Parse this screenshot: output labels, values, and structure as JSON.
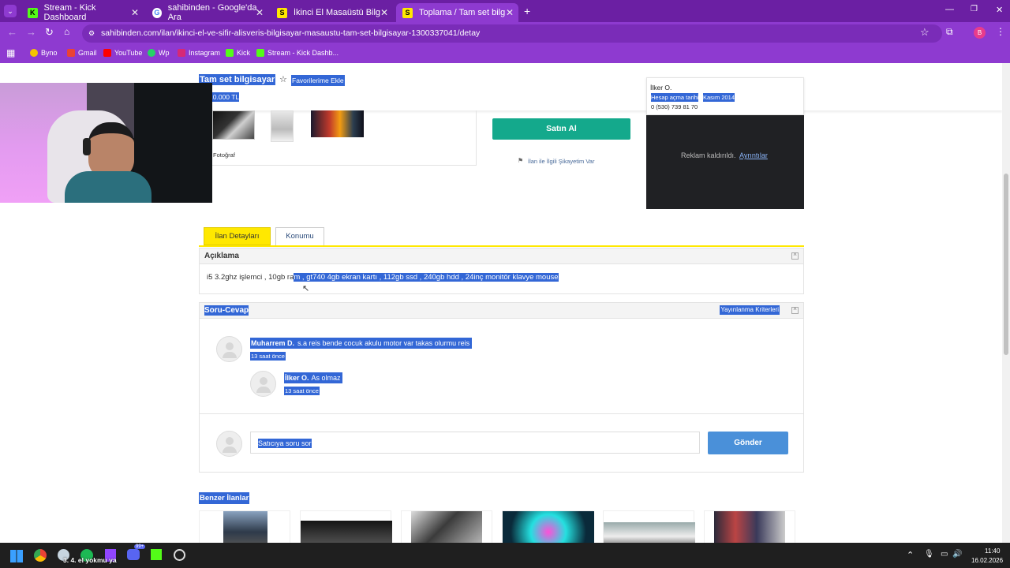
{
  "browser": {
    "tabs": [
      {
        "label": "Stream - Kick Dashboard",
        "icon": "kick-icon"
      },
      {
        "label": "sahibinden - Google'da Ara",
        "icon": "google-icon"
      },
      {
        "label": "İkinci El Masaüstü Bilgisayar M...",
        "icon": "sahibinden-icon"
      },
      {
        "label": "Toplama / Tam set bilgisayar sa...",
        "icon": "sahibinden-icon"
      }
    ],
    "url": "sahibinden.com/ilan/ikinci-el-ve-sifir-alisveris-bilgisayar-masaustu-tam-set-bilgisayar-1300337041/detay",
    "profile_initial": "B",
    "bookmarks": [
      "Byno",
      "Gmail",
      "YouTube",
      "Wp",
      "Instagram",
      "Kick",
      "Stream - Kick Dashb..."
    ]
  },
  "listing": {
    "title": "Tam set bilgisayar",
    "favorite_label": "Favorilerime Ekle",
    "price": "10.000 TL",
    "photo_label": "Fotoğraf",
    "buy_label": "Satın Al",
    "complaint_label": "İlan ile İlgili Şikayetim Var"
  },
  "seller": {
    "name": "İlker O.",
    "since_label": "Hesap açma tarihi",
    "since_value": "Kasım 2014",
    "phone": "0 (530) 739 81 70",
    "ad_removed": "Reklam kaldırıldı.",
    "ad_details": "Ayrıntılar"
  },
  "tabs": {
    "details": "İlan Detayları",
    "location": "Konumu"
  },
  "description": {
    "heading": "Açıklama",
    "text_plain": "i5 3.2ghz işlemci , 10gb ra",
    "text_selected": "m , gt740 4gb ekran kartı , 112gb ssd , 240gb hdd , 24inç monitör klavye mouse"
  },
  "qa": {
    "heading": "Soru-Cevap",
    "criteria": "Yayınlanma Kriterleri",
    "question_author": "Muharrem D.",
    "question_text": "s.a reis bende cocuk akulu motor var takas olurmu reis",
    "question_time": "13 saat önce",
    "answer_author": "İlker O.",
    "answer_text": "As olmaz",
    "answer_time": "13 saat önce",
    "input_placeholder": "Satıcıya soru sor",
    "send_label": "Gönder"
  },
  "similar_heading": "Benzer İlanlar",
  "taskbar": {
    "stream_text": "3. 4. el yokmu ya",
    "time": "11:40",
    "date": "16.02.2026",
    "notification_count": "99+"
  }
}
